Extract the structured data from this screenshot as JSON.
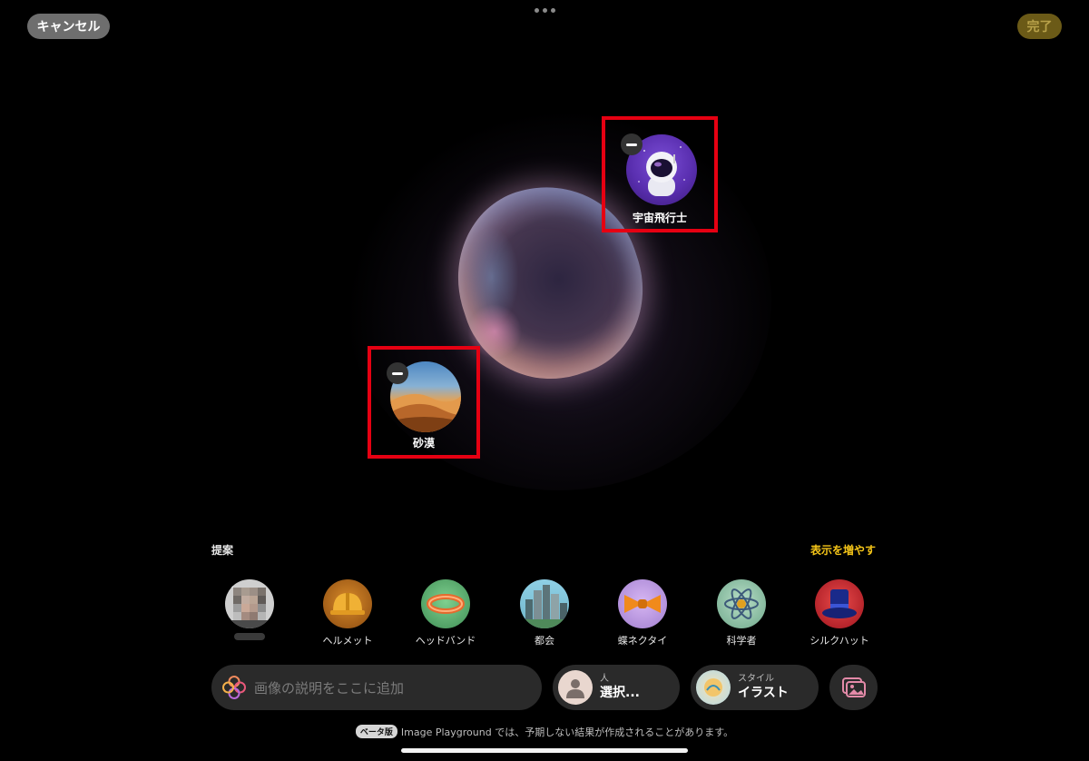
{
  "topbar": {
    "cancel_label": "キャンセル",
    "done_label": "完了"
  },
  "concepts": [
    {
      "label": "宇宙飛行士",
      "icon": "astronaut-icon"
    },
    {
      "label": "砂漠",
      "icon": "desert-icon"
    }
  ],
  "suggestions": {
    "title": "提案",
    "show_more": "表示を増やす",
    "items": [
      {
        "label": "",
        "icon": "person-photo-pixelated"
      },
      {
        "label": "ヘルメット",
        "icon": "helmet-icon"
      },
      {
        "label": "ヘッドバンド",
        "icon": "headband-icon"
      },
      {
        "label": "都会",
        "icon": "city-icon"
      },
      {
        "label": "蝶ネクタイ",
        "icon": "bowtie-icon"
      },
      {
        "label": "科学者",
        "icon": "atom-icon"
      },
      {
        "label": "シルクハット",
        "icon": "top-hat-icon"
      }
    ]
  },
  "input": {
    "placeholder": "画像の説明をここに追加"
  },
  "person_pill": {
    "small": "人",
    "big": "選択..."
  },
  "style_pill": {
    "small": "スタイル",
    "big": "イラスト"
  },
  "footer": {
    "badge": "ベータ版",
    "text": "Image Playground では、予期しない結果が作成されることがあります。"
  },
  "colors": {
    "accent_yellow": "#f5c518",
    "highlight_red": "#e60012",
    "background": "#000000"
  }
}
